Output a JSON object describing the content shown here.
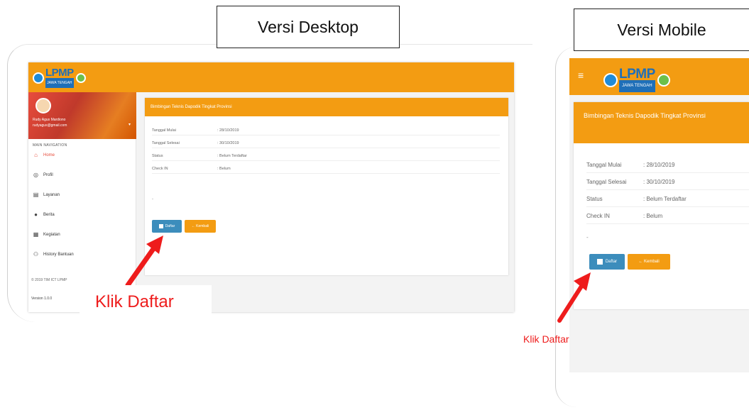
{
  "captions": {
    "desktop": "Versi Desktop",
    "mobile": "Versi Mobile"
  },
  "logo": {
    "text": "LPMP",
    "subtitle": "JAWA TENGAH"
  },
  "desktop": {
    "profile": {
      "name": "Rudy Agus Mardiono",
      "email": "rudyagus@gmail.com"
    },
    "nav_title": "MAIN NAVIGATION",
    "nav": [
      {
        "label": "Home",
        "icon": "home-icon",
        "glyph": "⌂"
      },
      {
        "label": "Profil",
        "icon": "user-icon",
        "glyph": "◎"
      },
      {
        "label": "Layanan",
        "icon": "book-icon",
        "glyph": "▤"
      },
      {
        "label": "Berita",
        "icon": "globe-icon",
        "glyph": "●"
      },
      {
        "label": "Kegiatan",
        "icon": "calendar-icon",
        "glyph": "▦"
      },
      {
        "label": "History Bantuan",
        "icon": "users-icon",
        "glyph": "⚇"
      }
    ],
    "footer_copyright": "© 2019 TIM ICT LPMP",
    "footer_version": "Version 1.0.0",
    "card_title": "Bimbingan Teknis Dapodik Tingkat Provinsi",
    "details": [
      {
        "label": "Tanggal Mulai",
        "value": ": 28/10/2019"
      },
      {
        "label": "Tanggal Selesai",
        "value": ": 30/10/2019"
      },
      {
        "label": "Status",
        "value": ": Belum Terdaftar"
      },
      {
        "label": "Check IN",
        "value": ": Belum"
      }
    ],
    "dash": "-",
    "daftar_label": "Daftar",
    "kembali_label": "← Kembali"
  },
  "mobile": {
    "menu_glyph": "≡",
    "card_title": "Bimbingan Teknis Dapodik Tingkat Provinsi",
    "details": [
      {
        "label": "Tanggal Mulai",
        "value": ": 28/10/2019"
      },
      {
        "label": "Tanggal Selesai",
        "value": ": 30/10/2019"
      },
      {
        "label": "Status",
        "value": ": Belum Terdaftar"
      },
      {
        "label": "Check IN",
        "value": ": Belum"
      }
    ],
    "dash": "-",
    "daftar_label": "Daftar",
    "kembali_label": "← Kembali"
  },
  "annotations": {
    "desktop_label": "Klik Daftar",
    "mobile_label": "Klik Daftar"
  },
  "colors": {
    "accent": "#f39c12",
    "primary_button": "#3c8dbc",
    "warning_button": "#f39c12",
    "arrow": "#ee1c1c"
  }
}
